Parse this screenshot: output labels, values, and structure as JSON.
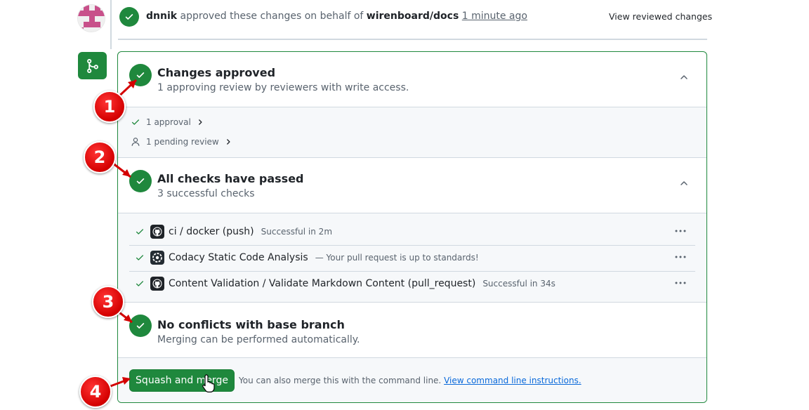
{
  "event": {
    "user": "dnnik",
    "action_text": "approved these changes on behalf of",
    "org": "wirenboard/docs",
    "time": "1 minute ago",
    "view_reviewed": "View reviewed changes"
  },
  "approved": {
    "title": "Changes approved",
    "subtitle": "1 approving review by reviewers with write access.",
    "approval_label": "1 approval",
    "pending_label": "1 pending review"
  },
  "checks": {
    "title": "All checks have passed",
    "subtitle": "3 successful checks",
    "items": [
      {
        "name": "ci / docker (push)",
        "desc": "Successful in 2m",
        "icon": "github-icon"
      },
      {
        "name": "Codacy Static Code Analysis",
        "desc": "— Your pull request is up to standards!",
        "icon": "codacy-icon"
      },
      {
        "name": "Content Validation / Validate Markdown Content (pull_request)",
        "desc": "Successful in 34s",
        "icon": "github-icon"
      }
    ]
  },
  "conflicts": {
    "title": "No conflicts with base branch",
    "subtitle": "Merging can be performed automatically."
  },
  "footer": {
    "merge_button": "Squash and merge",
    "cli_text": "You can also merge this with the command line.",
    "cli_link": "View command line instructions."
  },
  "markers": [
    "1",
    "2",
    "3",
    "4"
  ],
  "colors": {
    "success": "#1f883d",
    "marker": "#d40000",
    "link": "#0969da"
  }
}
